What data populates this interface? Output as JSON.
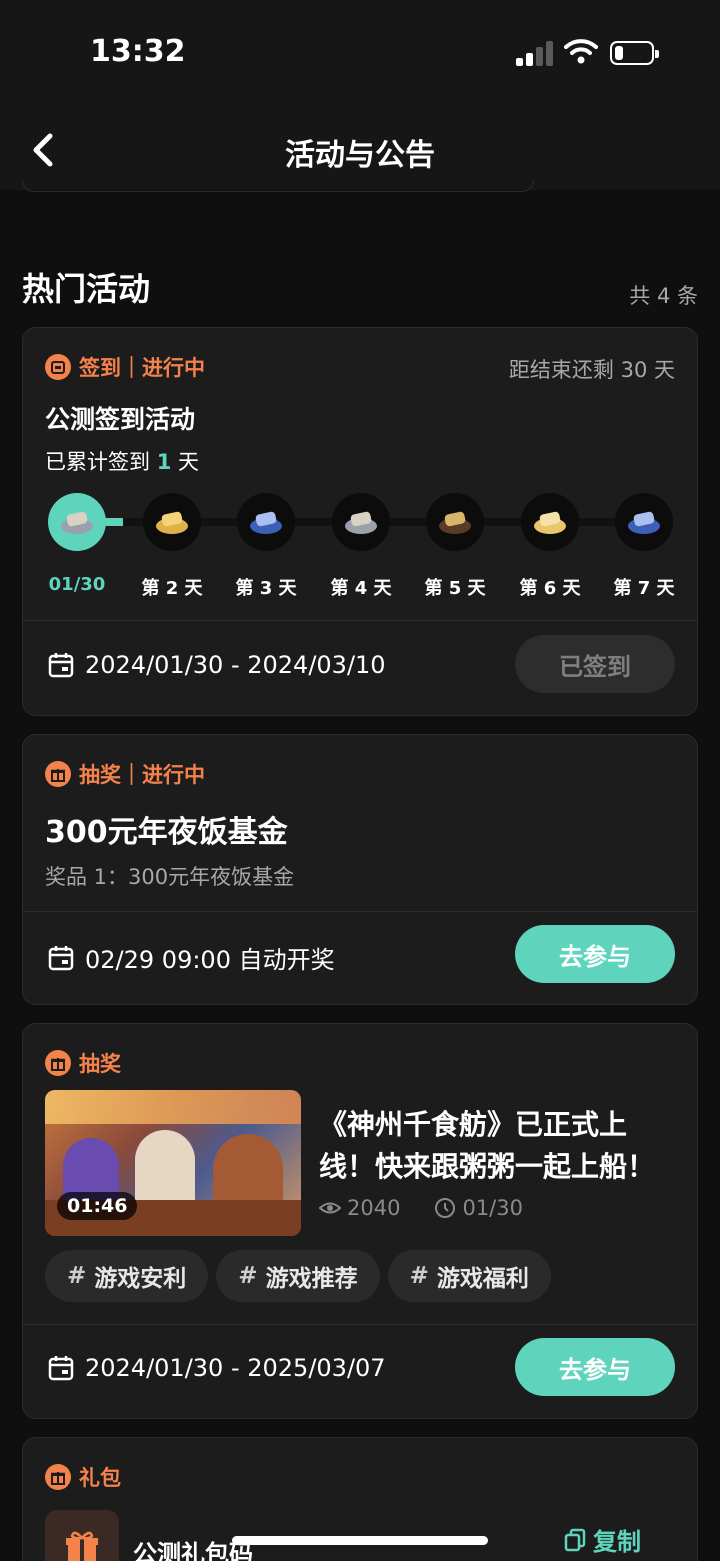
{
  "status_bar": {
    "time": "13:32"
  },
  "header": {
    "title": "活动与公告",
    "back_icon": "chevron-left-icon"
  },
  "section": {
    "title": "热门活动",
    "count": "共 4 条"
  },
  "accent_color": "#5fd4bd",
  "tag_color": "#f4824b",
  "checkin_card": {
    "tag": "签到｜进行中",
    "remaining": "距结束还剩 30 天",
    "title": "公测签到活动",
    "progress_prefix": "已累计签到 ",
    "progress_days": "1",
    "progress_suffix": " 天",
    "days": [
      {
        "label": "01/30",
        "icon": "fish-plate-icon",
        "signed": true
      },
      {
        "label": "第 2 天",
        "icon": "coins-icon",
        "signed": false
      },
      {
        "label": "第 3 天",
        "icon": "scroll-ticket-icon",
        "signed": false
      },
      {
        "label": "第 4 天",
        "icon": "fish-plate-icon",
        "signed": false
      },
      {
        "label": "第 5 天",
        "icon": "book-icon",
        "signed": false
      },
      {
        "label": "第 6 天",
        "icon": "tickets-icon",
        "signed": false
      },
      {
        "label": "第 7 天",
        "icon": "scroll-ticket-icon",
        "signed": false
      }
    ],
    "date_range": "2024/01/30 - 2024/03/10",
    "button": "已签到"
  },
  "lottery_card": {
    "tag": "抽奖｜进行中",
    "title": "300元年夜饭基金",
    "prize": "奖品 1：300元年夜饭基金",
    "draw_time": "02/29 09:00 自动开奖",
    "button": "去参与"
  },
  "video_card": {
    "tag": "抽奖",
    "duration": "01:46",
    "title": "《神州千食舫》已正式上线！快来跟粥粥一起上船！",
    "views": "2040",
    "date": "01/30",
    "tags": [
      "游戏安利",
      "游戏推荐",
      "游戏福利"
    ],
    "date_range": "2024/01/30 - 2025/03/07",
    "button": "去参与"
  },
  "gift_card": {
    "tag": "礼包",
    "name": "公测礼包码",
    "copy": "复制"
  }
}
